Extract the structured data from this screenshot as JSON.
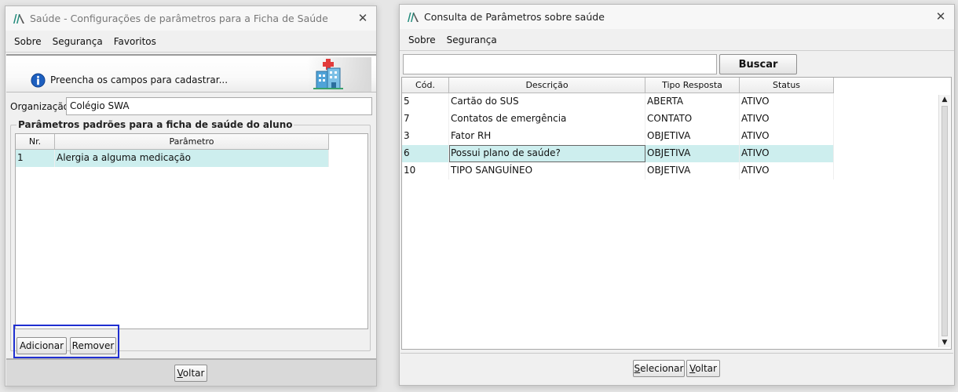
{
  "left_window": {
    "title": "Saúde - Configurações de parâmetros para a Ficha de Saúde",
    "menu": [
      "Sobre",
      "Segurança",
      "Favoritos"
    ],
    "banner_text": "Preencha os campos para cadastrar...",
    "org_label": "Organização:",
    "org_value": "Colégio SWA",
    "group_title": "Parâmetros padrões para a ficha de saúde do aluno",
    "table_headers": [
      "Nr.",
      "Parâmetro"
    ],
    "rows": [
      {
        "nr": "1",
        "param": "Alergia a alguma medicação"
      }
    ],
    "buttons": {
      "add": "Adicionar",
      "remove": "Remover",
      "back_rest": "oltar",
      "back_key": "V"
    }
  },
  "right_window": {
    "title": "Consulta de Parâmetros sobre saúde",
    "menu": [
      "Sobre",
      "Segurança"
    ],
    "search_value": "",
    "search_button": "Buscar",
    "table_headers": [
      "Cód.",
      "Descrição",
      "Tipo Resposta",
      "Status"
    ],
    "rows": [
      {
        "cod": "5",
        "desc": "Cartão do SUS",
        "tipo": "ABERTA",
        "status": "ATIVO"
      },
      {
        "cod": "7",
        "desc": "Contatos de emergência",
        "tipo": "CONTATO",
        "status": "ATIVO"
      },
      {
        "cod": "3",
        "desc": "Fator RH",
        "tipo": "OBJETIVA",
        "status": "ATIVO"
      },
      {
        "cod": "6",
        "desc": "Possui plano de saúde?",
        "tipo": "OBJETIVA",
        "status": "ATIVO"
      },
      {
        "cod": "10",
        "desc": "TIPO SANGUÍNEO",
        "tipo": "OBJETIVA",
        "status": "ATIVO"
      }
    ],
    "selected_row": 3,
    "buttons": {
      "select_key": "S",
      "select_rest": "elecionar",
      "back_key": "V",
      "back_rest": "oltar"
    }
  },
  "colors": {
    "selection": "#cdeeee",
    "highlight_border": "#1f2fd1",
    "logo": "#1f8a7a"
  },
  "icons": [
    "app-logo-icon",
    "close-icon",
    "info-icon",
    "hospital-icon",
    "scroll-up-icon",
    "scroll-down-icon"
  ]
}
